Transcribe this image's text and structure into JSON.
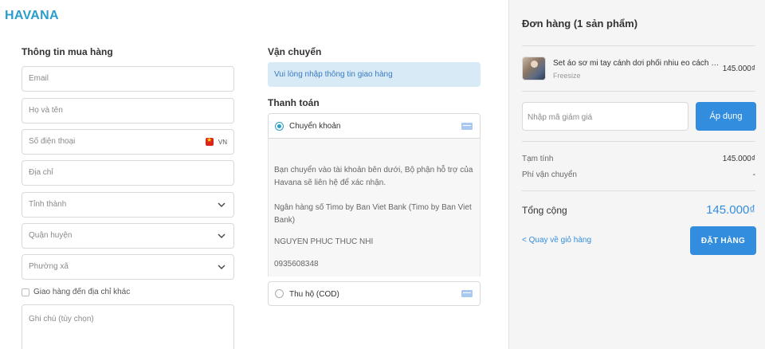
{
  "brand": {
    "name": "HAVANA"
  },
  "customer": {
    "title": "Thông tin mua hàng",
    "email_placeholder": "Email",
    "name_placeholder": "Họ và tên",
    "phone_placeholder": "Số điện thoại",
    "phone_country": "VN",
    "address_placeholder": "Địa chỉ",
    "province_placeholder": "Tỉnh thành",
    "district_placeholder": "Quận huyện",
    "ward_placeholder": "Phường xã",
    "ship_other_label": "Giao hàng đến địa chỉ khác",
    "note_placeholder": "Ghi chú (tùy chọn)"
  },
  "shipping": {
    "title": "Vận chuyển",
    "message": "Vui lòng nhập thông tin giao hàng"
  },
  "payment": {
    "title": "Thanh toán",
    "options": [
      {
        "label": "Chuyển khoản",
        "selected": true
      },
      {
        "label": "Thu hộ (COD)",
        "selected": false
      }
    ],
    "bank_info": {
      "intro": "Bạn chuyển vào tài khoản bên dưới, Bộ phận hỗ trợ của Havana sẽ liên hệ để xác nhận.",
      "bank": "Ngân hàng số Timo by Ban Viet Bank (Timo by Ban Viet Bank)",
      "account_name": "NGUYEN PHUC THUC NHI",
      "account_number": "0935608348"
    }
  },
  "order": {
    "title": "Đơn hàng (1 sản phẩm)",
    "item": {
      "name": "Set áo sơ mi tay cánh dơi phối nhiu eo cách điệu",
      "variant": "Freesize",
      "price": "145.000₫"
    },
    "coupon_placeholder": "Nhập mã giảm giá",
    "apply_label": "Áp dụng",
    "subtotal_label": "Tạm tính",
    "subtotal_value": "145.000₫",
    "shipping_label": "Phí vận chuyển",
    "shipping_value": "-",
    "total_label": "Tổng cộng",
    "total_value": "145.000₫",
    "back_label": "< Quay về giỏ hàng",
    "place_order_label": "ĐẶT HÀNG"
  },
  "colors": {
    "accent": "#338dde",
    "brand": "#2a9dcc",
    "alert_bg": "#d9eaf7"
  }
}
